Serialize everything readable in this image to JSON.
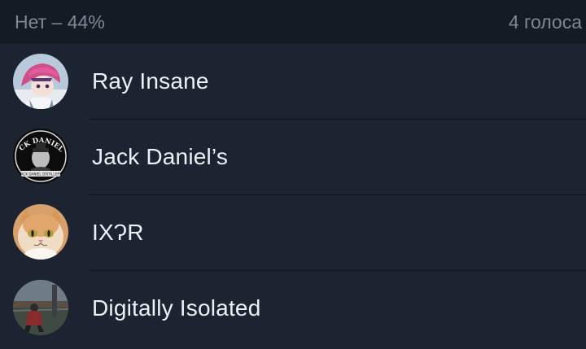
{
  "poll_option": {
    "title": "Нет – 44%",
    "votes": "4 голоса"
  },
  "voters": [
    {
      "name": "Ray Insane",
      "avatar": "anime-girl-avatar"
    },
    {
      "name": "Jack Daniel’s",
      "avatar": "jack-daniels-logo-avatar"
    },
    {
      "name": "IXɁR",
      "avatar": "cat-avatar"
    },
    {
      "name": "Digitally Isolated",
      "avatar": "person-sitting-avatar"
    }
  ],
  "avatar_labels": {
    "jack_top": "JACK DANIEL'S",
    "jack_bottom": "JACK DANIEL DISTILLERY"
  }
}
